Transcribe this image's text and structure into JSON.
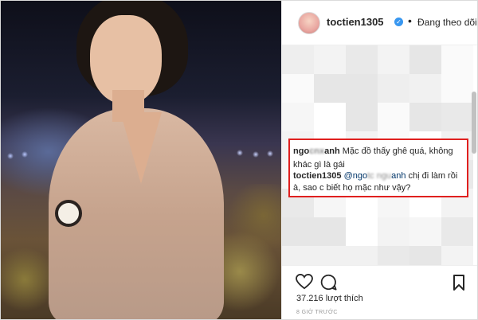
{
  "post": {
    "username": "toctien1305",
    "follow_status": "Đang theo dõi",
    "likes": "37.216 lượt thích",
    "timestamp": "8 GIỜ TRƯỚC"
  },
  "comments": [
    {
      "author": "ngo",
      "author_blurred": "cnx",
      "author_tail": "anh",
      "text": "Mặc đồ thấy ghê quá, không khác gì là gái"
    },
    {
      "author": "toctien1305",
      "mention": "@ngo",
      "mention_blurred": "tc ngu",
      "mention_tail": "anh",
      "text": "chị đi làm rồi à, sao c biết họ mặc như vậy?"
    }
  ],
  "icons": {
    "like": "heart-icon",
    "comment": "comment-icon",
    "save": "bookmark-icon",
    "verified": "verified-badge-icon"
  },
  "colors": {
    "highlight_border": "#e0201f",
    "verified": "#3897f0",
    "mention": "#003569"
  }
}
